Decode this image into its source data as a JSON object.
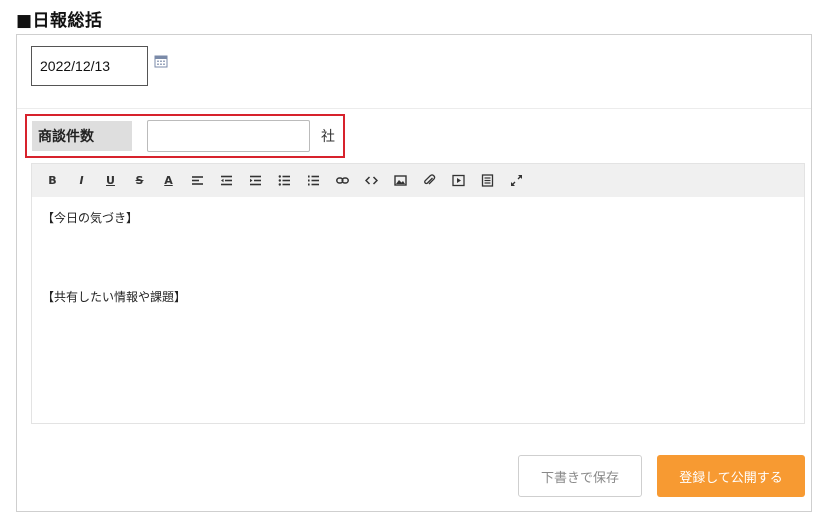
{
  "section": {
    "title": "■日報総括"
  },
  "date_field": {
    "value": "2022/12/13",
    "icon": "calendar-icon"
  },
  "deal_count": {
    "label": "商談件数",
    "value": "",
    "unit": "社",
    "highlight_color": "#d7222c"
  },
  "toolbar": {
    "buttons": [
      {
        "name": "bold",
        "glyph": "B"
      },
      {
        "name": "italic",
        "glyph": "I"
      },
      {
        "name": "underline",
        "glyph": "U"
      },
      {
        "name": "strikethrough",
        "glyph": "S"
      },
      {
        "name": "font-color",
        "glyph": "A"
      },
      {
        "name": "align-left",
        "icon": "align-left-icon"
      },
      {
        "name": "outdent",
        "icon": "outdent-icon"
      },
      {
        "name": "indent",
        "icon": "indent-icon"
      },
      {
        "name": "bullet-list",
        "icon": "bullet-list-icon"
      },
      {
        "name": "numbered-list",
        "icon": "numbered-list-icon"
      },
      {
        "name": "link",
        "icon": "link-icon"
      },
      {
        "name": "code",
        "icon": "code-icon"
      },
      {
        "name": "image",
        "icon": "image-icon"
      },
      {
        "name": "attachment",
        "icon": "paperclip-icon"
      },
      {
        "name": "video",
        "icon": "video-icon"
      },
      {
        "name": "template",
        "icon": "document-icon"
      },
      {
        "name": "fullscreen",
        "icon": "expand-icon"
      }
    ]
  },
  "editor": {
    "lines": [
      "【今日の気づき】",
      "【共有したい情報や課題】"
    ]
  },
  "actions": {
    "draft_label": "下書きで保存",
    "publish_label": "登録して公開する",
    "publish_color": "#f79a32"
  }
}
